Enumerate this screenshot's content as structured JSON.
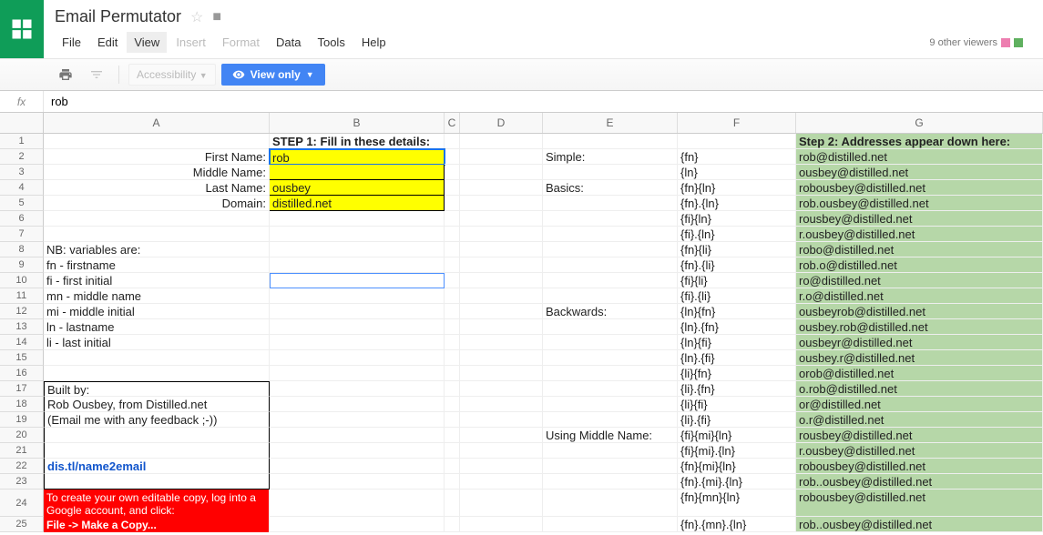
{
  "doc": {
    "title": "Email Permutator"
  },
  "menu": {
    "file": "File",
    "edit": "Edit",
    "view": "View",
    "insert": "Insert",
    "format": "Format",
    "data": "Data",
    "tools": "Tools",
    "help": "Help"
  },
  "viewers": {
    "text": "9 other viewers"
  },
  "toolbar": {
    "accessibility": "Accessibility",
    "viewonly": "View only"
  },
  "fx": {
    "value": "rob"
  },
  "columns": [
    "A",
    "B",
    "C",
    "D",
    "E",
    "F",
    "G"
  ],
  "rows": [
    {
      "n": "1",
      "A": "",
      "B": "STEP 1: Fill in these details:",
      "D": "",
      "E": "",
      "F": "",
      "G": "Step 2: Addresses appear down here:",
      "b_bold": true,
      "g_bold": true
    },
    {
      "n": "2",
      "A": "First Name:",
      "B": "rob",
      "E": "Simple:",
      "F": "{fn}",
      "G": "rob@distilled.net",
      "a_r": true,
      "b_y": true,
      "sel": true
    },
    {
      "n": "3",
      "A": "Middle Name:",
      "B": "",
      "E": "",
      "F": "{ln}",
      "G": "ousbey@distilled.net",
      "a_r": true,
      "b_y": true
    },
    {
      "n": "4",
      "A": "Last Name:",
      "B": "ousbey",
      "E": "Basics:",
      "F": "{fn}{ln}",
      "G": "robousbey@distilled.net",
      "a_r": true,
      "b_y": true
    },
    {
      "n": "5",
      "A": "Domain:",
      "B": "distilled.net",
      "E": "",
      "F": "{fn}.{ln}",
      "G": "rob.ousbey@distilled.net",
      "a_r": true,
      "b_y": true
    },
    {
      "n": "6",
      "A": "",
      "B": "",
      "E": "",
      "F": "{fi}{ln}",
      "G": "rousbey@distilled.net"
    },
    {
      "n": "7",
      "A": "",
      "B": "",
      "E": "",
      "F": "{fi}.{ln}",
      "G": "r.ousbey@distilled.net"
    },
    {
      "n": "8",
      "A": "NB: variables are:",
      "B": "",
      "E": "",
      "F": "{fn}{li}",
      "G": "robo@distilled.net"
    },
    {
      "n": "9",
      "A": "fn - firstname",
      "B": "",
      "E": "",
      "F": "{fn}.{li}",
      "G": "rob.o@distilled.net"
    },
    {
      "n": "10",
      "A": "fi - first initial",
      "B": "",
      "E": "",
      "F": "{fi}{li}",
      "G": "ro@distilled.net",
      "thin": true
    },
    {
      "n": "11",
      "A": "mn - middle name",
      "B": "",
      "E": "",
      "F": "{fi}.{li}",
      "G": "r.o@distilled.net"
    },
    {
      "n": "12",
      "A": "mi - middle initial",
      "B": "",
      "E": "Backwards:",
      "F": "{ln}{fn}",
      "G": "ousbeyrob@distilled.net"
    },
    {
      "n": "13",
      "A": "ln - lastname",
      "B": "",
      "E": "",
      "F": "{ln}.{fn}",
      "G": "ousbey.rob@distilled.net"
    },
    {
      "n": "14",
      "A": "li - last initial",
      "B": "",
      "E": "",
      "F": "{ln}{fi}",
      "G": "ousbeyr@distilled.net"
    },
    {
      "n": "15",
      "A": "",
      "B": "",
      "E": "",
      "F": "{ln}.{fi}",
      "G": "ousbey.r@distilled.net"
    },
    {
      "n": "16",
      "A": "",
      "B": "",
      "E": "",
      "F": "{li}{fn}",
      "G": "orob@distilled.net"
    },
    {
      "n": "17",
      "A": "Built by:",
      "B": "",
      "E": "",
      "F": "{li}.{fn}",
      "G": "o.rob@distilled.net",
      "cb_top": true
    },
    {
      "n": "18",
      "A": "Rob Ousbey, from Distilled.net",
      "B": "",
      "E": "",
      "F": "{li}{fi}",
      "G": "or@distilled.net"
    },
    {
      "n": "19",
      "A": "(Email me with any feedback ;-))",
      "B": "",
      "E": "",
      "F": "{li}.{fi}",
      "G": "o.r@distilled.net"
    },
    {
      "n": "20",
      "A": "",
      "B": "",
      "E": "Using Middle Name:",
      "F": "{fi}{mi}{ln}",
      "G": "rousbey@distilled.net"
    },
    {
      "n": "21",
      "A": "",
      "B": "",
      "E": "",
      "F": "{fi}{mi}.{ln}",
      "G": "r.ousbey@distilled.net"
    },
    {
      "n": "22",
      "A": "dis.tl/name2email",
      "B": "",
      "E": "",
      "F": "{fn}{mi}{ln}",
      "G": "robousbey@distilled.net",
      "link": true
    },
    {
      "n": "23",
      "A": "",
      "B": "",
      "E": "",
      "F": "{fn}.{mi}.{ln}",
      "G": "rob..ousbey@distilled.net",
      "cb_bot": true
    },
    {
      "n": "24",
      "A": "To create your own editable copy, log into a Google account, and click:",
      "B": "",
      "E": "",
      "F": "{fn}{mn}{ln}",
      "G": "robousbey@distilled.net",
      "red": true,
      "tall": true
    },
    {
      "n": "25",
      "A": "File -> Make a Copy...",
      "B": "",
      "E": "",
      "F": "{fn}.{mn}.{ln}",
      "G": "rob..ousbey@distilled.net",
      "red": true,
      "red_bold": true
    }
  ]
}
